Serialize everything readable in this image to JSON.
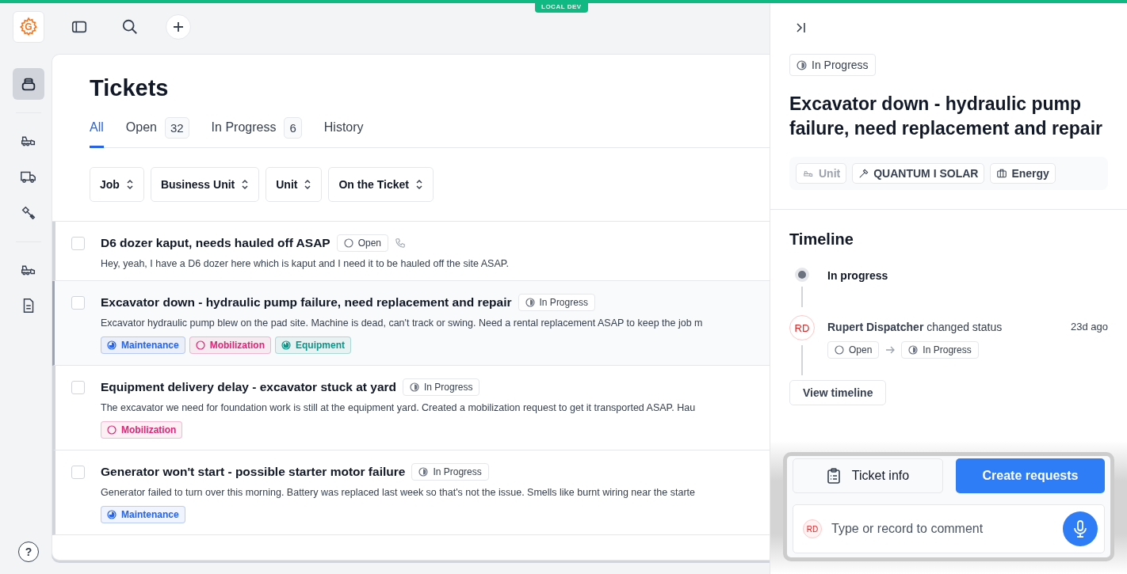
{
  "env_badge": "LOCAL DEV",
  "app": {
    "logo_letter": "G",
    "help": "?"
  },
  "sidebar": {
    "items": [
      {
        "kind": "stack",
        "selected": true
      },
      {
        "kind": "dozer",
        "selected": false
      },
      {
        "kind": "truck",
        "selected": false
      },
      {
        "kind": "tools",
        "selected": false
      },
      {
        "kind": "dozer",
        "selected": false
      },
      {
        "kind": "document",
        "selected": false
      }
    ]
  },
  "page": {
    "title": "Tickets",
    "tabs": [
      {
        "label": "All",
        "selected": true
      },
      {
        "label": "Open",
        "count": "32",
        "selected": false
      },
      {
        "label": "In Progress",
        "count": "6",
        "selected": false
      },
      {
        "label": "History",
        "selected": false
      }
    ],
    "filters": [
      "Job",
      "Business Unit",
      "Unit",
      "On the Ticket"
    ]
  },
  "tickets": [
    {
      "title": "D6 dozer kaput, needs hauled off ASAP",
      "status": {
        "label": "Open",
        "kind": "open"
      },
      "phone": true,
      "selected": false,
      "checked": false,
      "description": "Hey, yeah, I have a D6 dozer here which is kaput and I need it to be hauled off the site ASAP."
    },
    {
      "title": "Excavator down - hydraulic pump failure, need replacement and repair",
      "status": {
        "label": "In Progress",
        "kind": "in_progress"
      },
      "phone": false,
      "selected": true,
      "checked": false,
      "description": "Excavator hydraulic pump blew on the pad site. Machine is dead, can't track or swing. Need a rental replacement ASAP to keep the job m",
      "tags": [
        {
          "label": "Maintenance",
          "kind": "half",
          "color": "#2563eb"
        },
        {
          "label": "Mobilization",
          "kind": "empty",
          "color": "#db2777"
        },
        {
          "label": "Equipment",
          "kind": "most",
          "color": "#0d9488"
        }
      ]
    },
    {
      "title": "Equipment delivery delay - excavator stuck at yard",
      "status": {
        "label": "In Progress",
        "kind": "in_progress"
      },
      "phone": false,
      "selected": false,
      "checked": false,
      "description": "The excavator we need for foundation work is still at the equipment yard. Created a mobilization request to get it transported ASAP. Hau",
      "tags": [
        {
          "label": "Mobilization",
          "kind": "empty",
          "color": "#db2777"
        }
      ]
    },
    {
      "title": "Generator won't start - possible starter motor failure",
      "status": {
        "label": "In Progress",
        "kind": "in_progress"
      },
      "phone": false,
      "selected": false,
      "checked": false,
      "description": "Generator failed to turn over this morning. Battery was replaced last week so that's not the issue. Smells like burnt wiring near the starte",
      "tags": [
        {
          "label": "Maintenance",
          "kind": "half",
          "color": "#2563eb"
        }
      ]
    }
  ],
  "detail": {
    "status": {
      "label": "In Progress",
      "kind": "in_progress"
    },
    "title": "Excavator down - hydraulic pump failure, need replacement and repair",
    "chips": [
      {
        "label": "Unit",
        "kind": "unit",
        "muted": true
      },
      {
        "label": "QUANTUM I SOLAR",
        "kind": "job",
        "muted": false
      },
      {
        "label": "Energy",
        "kind": "business",
        "muted": false
      }
    ],
    "timeline": {
      "title": "Timeline",
      "current": "In progress",
      "events": [
        {
          "avatar": "RD",
          "text": "**Rupert Dispatcher** changed status",
          "time": "23d ago",
          "from": {
            "label": "Open",
            "kind": "open"
          },
          "to": {
            "label": "In Progress",
            "kind": "in_progress"
          }
        }
      ],
      "button": "View timeline"
    },
    "actions": {
      "info": "Ticket info",
      "create": "Create requests"
    },
    "comment": {
      "avatar": "RD",
      "placeholder": "Type or record to comment"
    }
  }
}
